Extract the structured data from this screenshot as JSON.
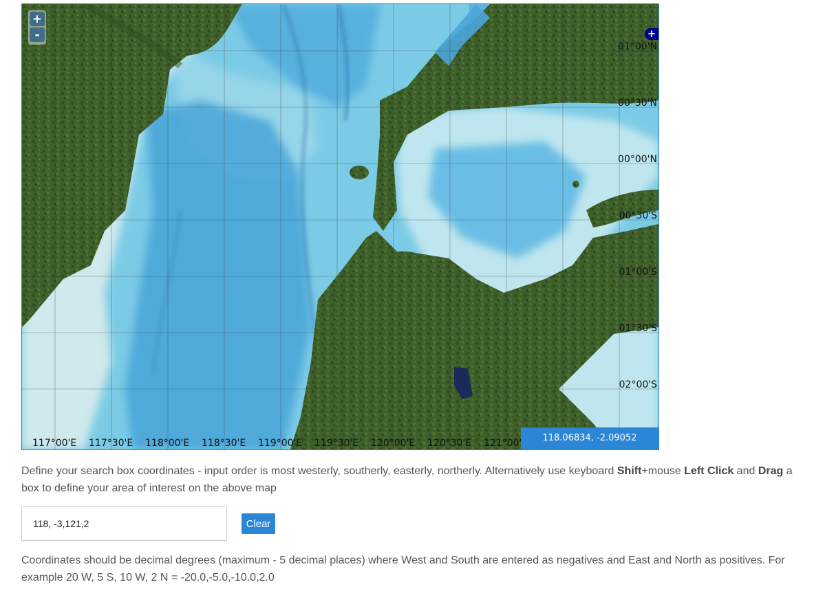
{
  "map": {
    "zoom_in_label": "+",
    "zoom_out_label": "-",
    "layer_switcher_label": "+",
    "lat_labels": [
      "01°00'N",
      "00°30'N",
      "00°00'N",
      "00°30'S",
      "01°00'S",
      "01°30'S",
      "02°00'S"
    ],
    "lon_labels": [
      "117°00'E",
      "117°30'E",
      "118°00'E",
      "118°30'E",
      "119°00'E",
      "119°30'E",
      "120°00'E",
      "120°30'E",
      "121°00'"
    ],
    "mouse_position": "118.06834, -2.09052",
    "colors": {
      "deep_sea": "#3aa0d8",
      "mid_sea": "#5fbde6",
      "shallow_sea": "#a8dceb",
      "shelf": "#cde9ec",
      "land": "#3e5e2a",
      "border": "#2d7fc6"
    }
  },
  "instructions": {
    "part1": "Define your search box coordinates - input order is most westerly, southerly, easterly, northerly. Alternatively use keyboard ",
    "shift": "Shift",
    "plus_mouse": "+mouse ",
    "left_click": "Left Click",
    "and": " and ",
    "drag": "Drag",
    "part2": " a box to define your area of interest on the above map"
  },
  "search": {
    "value": "118, -3,121,2",
    "clear_label": "Clear"
  },
  "note": "Coordinates should be decimal degrees (maximum - 5 decimal places) where West and South are entered as negatives and East and North as positives. For example 20 W, 5 S, 10 W, 2 N = -20.0,-5.0,-10.0,2.0"
}
